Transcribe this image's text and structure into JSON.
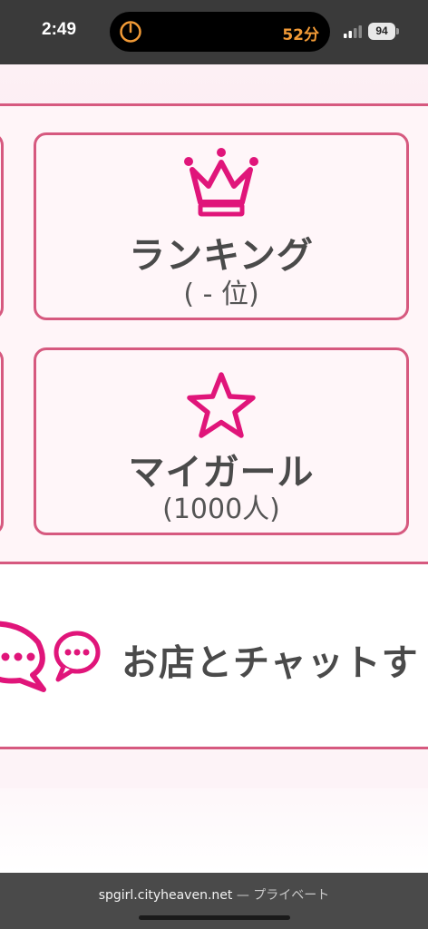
{
  "status_bar": {
    "time": "2:49",
    "timer_label": "52分",
    "battery_level": "94",
    "timer_color": "#f29a36"
  },
  "cards": {
    "ranking": {
      "icon": "crown-icon",
      "title": "ランキング",
      "subtitle": "( - 位)"
    },
    "my_girl": {
      "icon": "star-icon",
      "title": "マイガール",
      "subtitle": "(1000人)"
    }
  },
  "chat": {
    "label": "お店とチャットす",
    "icons": [
      "chat-bubble-icon",
      "chat-bubble-icon"
    ]
  },
  "browser": {
    "domain": "spgirl.cityheaven.net",
    "separator": " — ",
    "mode": "プライベート"
  },
  "colors": {
    "accent": "#e0157a",
    "border": "#d6597f",
    "text": "#4a4a4a"
  }
}
